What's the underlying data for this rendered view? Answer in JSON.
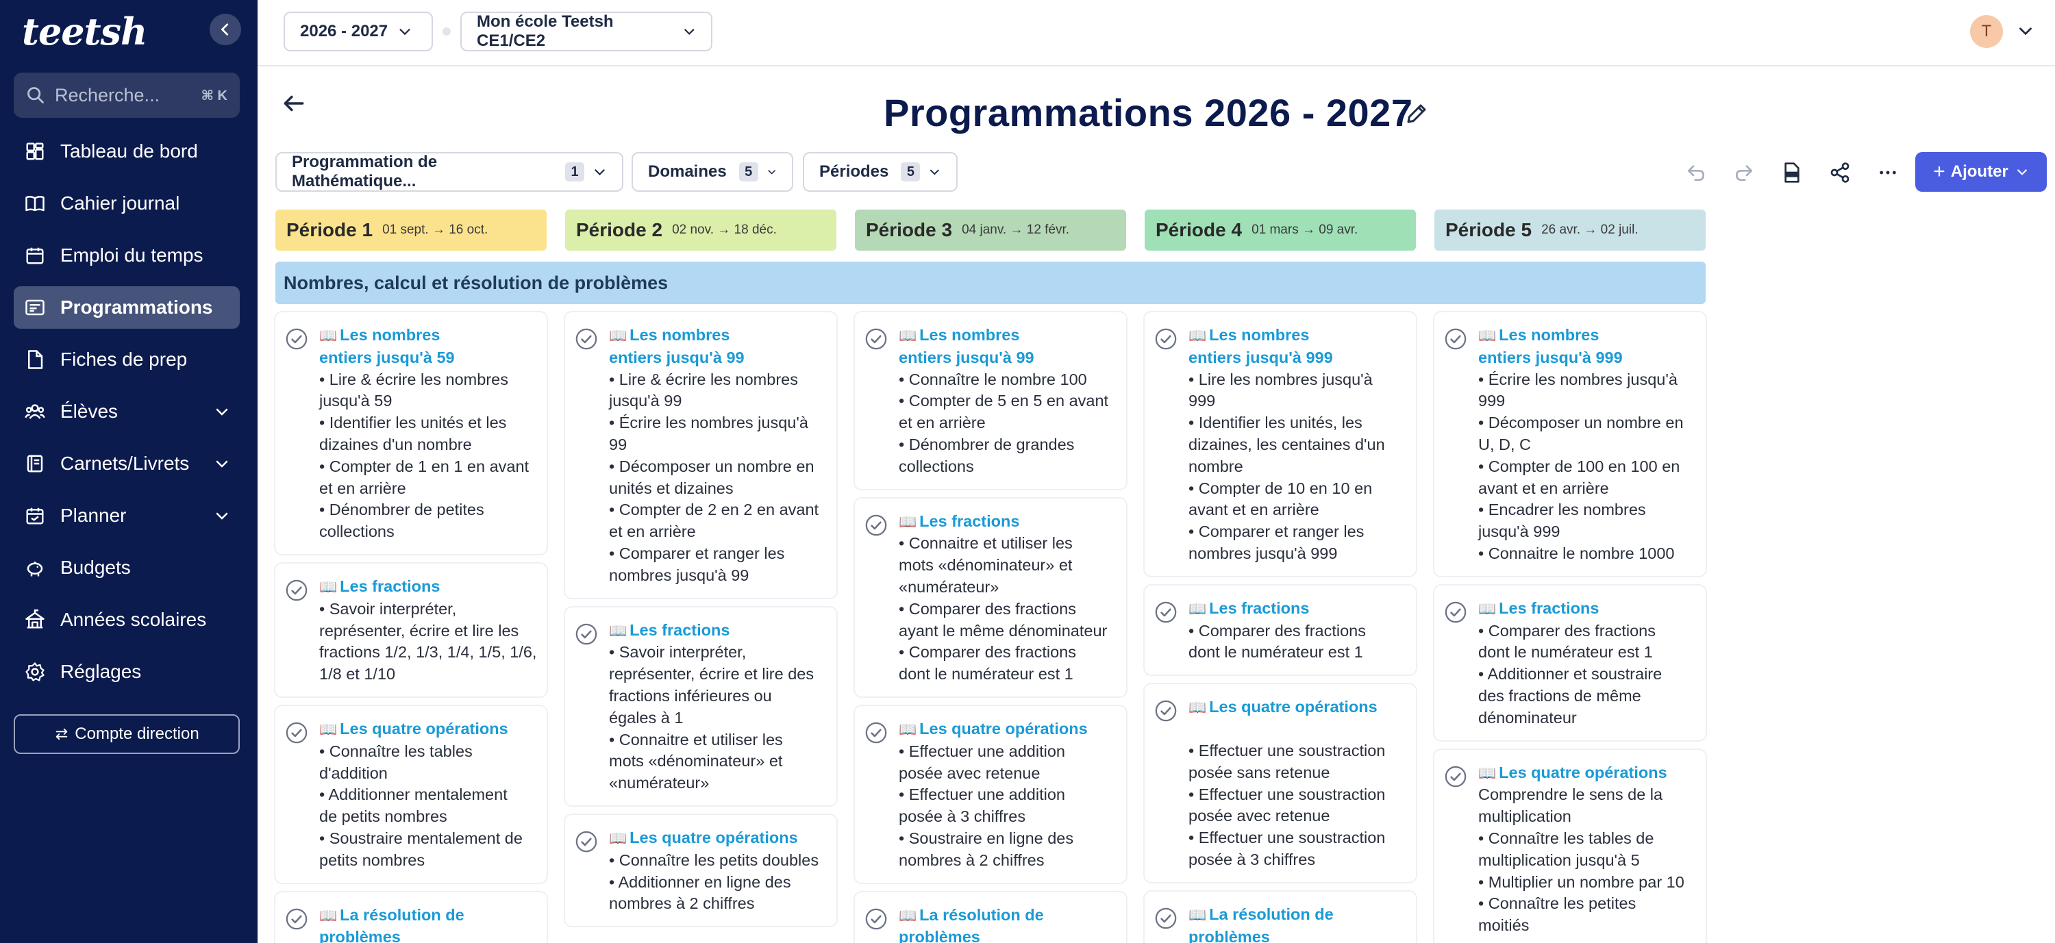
{
  "app": {
    "logo": "teetsh",
    "search_placeholder": "Recherche...",
    "search_shortcut": "⌘ K",
    "nav": [
      {
        "label": "Tableau de bord",
        "icon": "dashboard-icon"
      },
      {
        "label": "Cahier journal",
        "icon": "book-icon"
      },
      {
        "label": "Emploi du temps",
        "icon": "calendar-icon"
      },
      {
        "label": "Programmations",
        "icon": "program-icon",
        "active": true
      },
      {
        "label": "Fiches de prep",
        "icon": "document-icon"
      },
      {
        "label": "Élèves",
        "icon": "students-icon",
        "expandable": true
      },
      {
        "label": "Carnets/Livrets",
        "icon": "notebook-icon",
        "expandable": true
      },
      {
        "label": "Planner",
        "icon": "planner-icon",
        "expandable": true
      },
      {
        "label": "Budgets",
        "icon": "piggy-bank-icon"
      },
      {
        "label": "Années scolaires",
        "icon": "school-icon"
      },
      {
        "label": "Réglages",
        "icon": "gear-icon"
      }
    ],
    "direction_button": "Compte direction"
  },
  "topbar": {
    "year_select": "2026 - 2027",
    "school_select": "Mon école Teetsh CE1/CE2",
    "avatar_initial": "T"
  },
  "page": {
    "title": "Programmations 2026 - 2027"
  },
  "filters": {
    "programmation": {
      "label": "Programmation de Mathématique...",
      "count": "1"
    },
    "domaines": {
      "label": "Domaines",
      "count": "5"
    },
    "periodes": {
      "label": "Périodes",
      "count": "5"
    },
    "add_button": "Ajouter"
  },
  "colors": {
    "sidebar": "#0c1b4d",
    "accent": "#4a5ce0",
    "period1": "#fbe38e",
    "period2": "#dbeeaa",
    "period3": "#b5d9b6",
    "period4": "#9fe0b7",
    "period5": "#c8e2e7",
    "domain": "#b3d8f3",
    "card_title": "#1a9ad6"
  },
  "periods": [
    {
      "name": "Période 1",
      "dates": "01 sept. → 16 oct."
    },
    {
      "name": "Période 2",
      "dates": "02 nov. → 18 déc."
    },
    {
      "name": "Période 3",
      "dates": "04 janv. → 12 févr."
    },
    {
      "name": "Période 4",
      "dates": "01 mars → 09 avr."
    },
    {
      "name": "Période 5",
      "dates": "26 avr. → 02 juil."
    }
  ],
  "domain": "Nombres, calcul et résolution de problèmes",
  "columns": [
    {
      "cards": [
        {
          "title": [
            "Les nombres",
            "entiers jusqu'à 59"
          ],
          "lines": [
            "• Lire & écrire les nombres",
            "jusqu'à 59",
            "• Identifier les unités et les",
            "dizaines d'un nombre",
            "• Compter de 1 en 1 en avant",
            "et en arrière",
            "• Dénombrer de petites",
            "collections"
          ]
        },
        {
          "title": [
            "Les fractions"
          ],
          "lines": [
            "• Savoir interpréter,",
            "représenter, écrire et lire les",
            "fractions 1/2, 1/3, 1/4, 1/5, 1/6,",
            "1/8 et 1/10"
          ]
        },
        {
          "title": [
            "Les quatre opérations"
          ],
          "lines": [
            "• Connaître les tables",
            "d'addition",
            "• Additionner mentalement",
            "de petits nombres",
            "• Soustraire mentalement de",
            "petits nombres"
          ]
        },
        {
          "title": [
            "La résolution de",
            "problèmes"
          ],
          "lines": []
        }
      ]
    },
    {
      "cards": [
        {
          "title": [
            "Les nombres",
            "entiers jusqu'à 99"
          ],
          "lines": [
            "• Lire & écrire les nombres",
            "jusqu'à 99",
            "• Écrire les nombres jusqu'à",
            "99",
            "• Décomposer un nombre en",
            "unités et dizaines",
            "• Compter de 2 en 2 en avant",
            "et en arrière",
            "• Comparer et ranger les",
            "nombres jusqu'à 99"
          ]
        },
        {
          "title": [
            "Les fractions"
          ],
          "lines": [
            "• Savoir interpréter,",
            "représenter, écrire et lire des",
            "fractions inférieures ou",
            "égales à 1",
            "• Connaitre et utiliser les",
            "mots «dénominateur» et",
            "«numérateur»"
          ]
        },
        {
          "title": [
            "Les quatre opérations"
          ],
          "lines": [
            "• Connaître les petits doubles",
            "• Additionner en ligne des",
            "nombres à 2 chiffres"
          ]
        }
      ]
    },
    {
      "cards": [
        {
          "title": [
            "Les nombres",
            "entiers jusqu'à 99"
          ],
          "lines": [
            "• Connaître le nombre 100",
            "• Compter de 5 en 5 en avant",
            "et en arrière",
            "• Dénombrer de grandes",
            "collections"
          ]
        },
        {
          "title": [
            "Les fractions"
          ],
          "lines": [
            "• Connaitre et utiliser les",
            "mots «dénominateur» et",
            "«numérateur»",
            "• Comparer des fractions",
            "ayant le même dénominateur",
            "• Comparer des fractions",
            "dont le numérateur est 1"
          ]
        },
        {
          "title": [
            "Les quatre opérations"
          ],
          "lines": [
            "• Effectuer une addition",
            "posée avec retenue",
            "• Effectuer une addition",
            "posée à 3 chiffres",
            "• Soustraire en ligne des",
            "nombres à 2 chiffres"
          ]
        },
        {
          "title": [
            "La résolution de",
            "problèmes"
          ],
          "lines": []
        }
      ]
    },
    {
      "cards": [
        {
          "title": [
            "Les nombres",
            "entiers jusqu'à 999"
          ],
          "lines": [
            "• Lire les nombres jusqu'à",
            "999",
            "• Identifier les unités, les",
            "dizaines, les centaines d'un",
            "nombre",
            "• Compter de 10 en 10 en",
            "avant et en arrière",
            "• Comparer et ranger les",
            "nombres jusqu'à 999"
          ]
        },
        {
          "title": [
            "Les fractions"
          ],
          "lines": [
            "• Comparer des fractions",
            "dont le numérateur est 1"
          ]
        },
        {
          "title": [
            "Les quatre opérations"
          ],
          "lines": [
            "",
            "• Effectuer une soustraction",
            "posée sans retenue",
            "• Effectuer une soustraction",
            "posée avec retenue",
            "• Effectuer une soustraction",
            "posée à 3 chiffres"
          ]
        },
        {
          "title": [
            "La résolution de",
            "problèmes"
          ],
          "lines": []
        }
      ]
    },
    {
      "cards": [
        {
          "title": [
            "Les nombres",
            "entiers jusqu'à 999"
          ],
          "lines": [
            "• Écrire les nombres jusqu'à",
            "999",
            "• Décomposer un nombre en",
            "U, D, C",
            "• Compter de 100 en 100 en",
            "avant et en arrière",
            "• Encadrer les nombres",
            "jusqu'à 999",
            "• Connaitre le nombre 1000"
          ]
        },
        {
          "title": [
            "Les fractions"
          ],
          "lines": [
            "• Comparer des fractions",
            "dont le numérateur est 1",
            "• Additionner et soustraire",
            "des fractions de même",
            "dénominateur"
          ]
        },
        {
          "title": [
            "Les quatre opérations"
          ],
          "lines": [
            "Comprendre le sens de la",
            "multiplication",
            "• Connaître les tables de",
            "multiplication jusqu'à 5",
            "• Multiplier un nombre par 10",
            "• Connaître les petites",
            "moitiés"
          ]
        }
      ]
    }
  ]
}
